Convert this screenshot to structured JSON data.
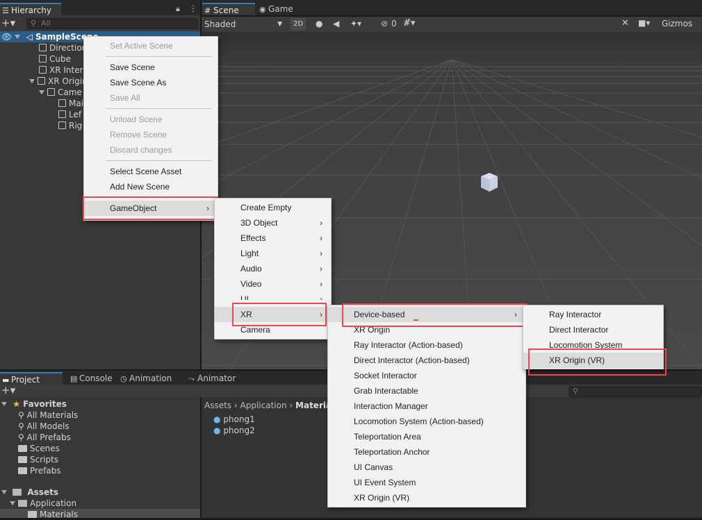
{
  "hierarchy": {
    "tab_label": "Hierarchy",
    "search_placeholder": "All",
    "scene_name": "SampleScene",
    "items": [
      "Direction",
      "Cube",
      "XR Intera",
      "XR Origin",
      "Came",
      "Mai",
      "Lef",
      "Rig"
    ]
  },
  "scene_view": {
    "tabs": [
      "Scene",
      "Game"
    ],
    "shading_mode": "Shaded",
    "mode_2d": "2D",
    "hidden_count": "0",
    "gizmos_label": "Gizmos"
  },
  "context_menu": {
    "items": [
      {
        "label": "Set Active Scene",
        "disabled": true
      },
      {
        "label": "Save Scene",
        "disabled": false
      },
      {
        "label": "Save Scene As",
        "disabled": false
      },
      {
        "label": "Save All",
        "disabled": true
      },
      {
        "label": "Unload Scene",
        "disabled": true
      },
      {
        "label": "Remove Scene",
        "disabled": true
      },
      {
        "label": "Discard changes",
        "disabled": true
      },
      {
        "label": "Select Scene Asset",
        "disabled": false
      },
      {
        "label": "Add New Scene",
        "disabled": false
      },
      {
        "label": "GameObject",
        "disabled": false
      }
    ]
  },
  "gameobject_menu": {
    "items": [
      "Create Empty",
      "3D Object",
      "Effects",
      "Light",
      "Audio",
      "Video",
      "UI",
      "XR",
      "Camera"
    ]
  },
  "xr_menu": {
    "items": [
      "Device-based",
      "XR Origin",
      "Ray Interactor (Action-based)",
      "Direct Interactor (Action-based)",
      "Socket Interactor",
      "Grab Interactable",
      "Interaction Manager",
      "Locomotion System (Action-based)",
      "Teleportation Area",
      "Teleportation Anchor",
      "UI Canvas",
      "UI Event System",
      "XR Origin (VR)"
    ]
  },
  "device_menu": {
    "items": [
      "Ray Interactor",
      "Direct Interactor",
      "Locomotion System",
      "XR Origin (VR)"
    ]
  },
  "bottom_tabs": [
    "Project",
    "Console",
    "Animation",
    "Animator"
  ],
  "project": {
    "favorites_label": "Favorites",
    "favorites": [
      "All Materials",
      "All Models",
      "All Prefabs",
      "Scenes",
      "Scripts",
      "Prefabs"
    ],
    "assets_label": "Assets",
    "assets_tree": [
      "Application",
      "Materials"
    ],
    "breadcrumb": [
      "Assets",
      "Application",
      "Materia"
    ],
    "files": [
      "phong1",
      "phong2"
    ]
  },
  "colors": {
    "highlight_red": "#e8484e",
    "accent_blue": "#3a79bb"
  }
}
